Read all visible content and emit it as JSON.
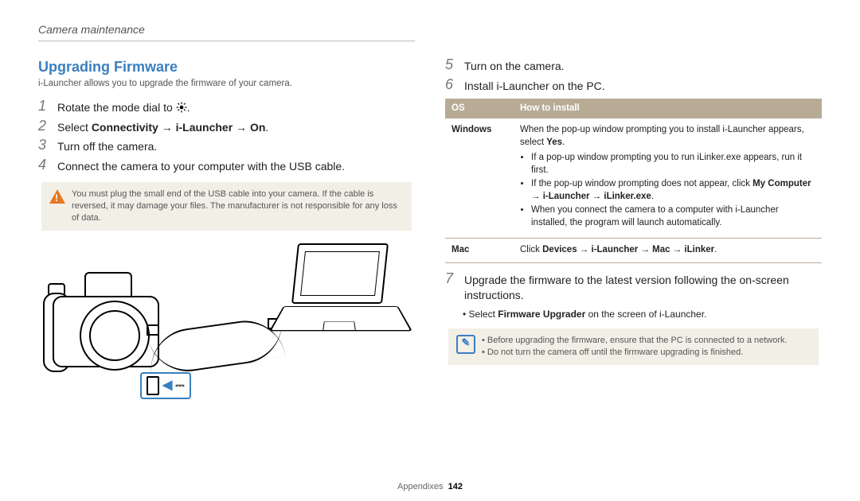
{
  "breadcrumb": "Camera maintenance",
  "section_title": "Upgrading Firmware",
  "intro": "i-Launcher allows you to upgrade the firmware of your camera.",
  "steps_left": [
    {
      "n": "1",
      "plain_pre": "Rotate the mode dial to ",
      "has_gear": true,
      "plain_post": "."
    },
    {
      "n": "2",
      "plain_pre": "Select ",
      "bold": "Connectivity → i-Launcher → On",
      "plain_post": "."
    },
    {
      "n": "3",
      "plain_pre": "Turn off the camera."
    },
    {
      "n": "4",
      "plain_pre": "Connect the camera to your computer with the USB cable."
    }
  ],
  "warning_text": "You must plug the small end of the USB cable into your camera. If the cable is reversed, it may damage your files. The manufacturer is not responsible for any loss of data.",
  "steps_right": [
    {
      "n": "5",
      "plain_pre": "Turn on the camera."
    },
    {
      "n": "6",
      "plain_pre": "Install i-Launcher on the PC."
    }
  ],
  "table": {
    "head_os": "OS",
    "head_how": "How to install",
    "windows": {
      "os": "Windows",
      "lead_pre": "When the pop-up window prompting you to install i-Launcher appears, select ",
      "lead_bold": "Yes",
      "lead_post": ".",
      "b1": "If a pop-up window prompting you to run iLinker.exe appears, run it first.",
      "b2_pre": "If the pop-up window prompting does not appear, click ",
      "b2_bold": "My Computer → i-Launcher → iLinker.exe",
      "b2_post": ".",
      "b3": "When you connect the camera to a computer with i-Launcher installed, the program will launch automatically."
    },
    "mac": {
      "os": "Mac",
      "text_pre": "Click ",
      "text_bold": "Devices → i-Launcher → Mac → iLinker",
      "text_post": "."
    }
  },
  "step7": {
    "n": "7",
    "text": "Upgrade the firmware to the latest version following the on-screen instructions."
  },
  "sub_pre": "Select ",
  "sub_bold": "Firmware Upgrader",
  "sub_post": " on the screen of i-Launcher.",
  "notes": [
    "Before upgrading the firmware, ensure that the PC is connected to a network.",
    "Do not turn the camera off until the firmware upgrading is finished."
  ],
  "footer_label": "Appendixes",
  "footer_page": "142",
  "usb_symbol": "⌿⎍"
}
